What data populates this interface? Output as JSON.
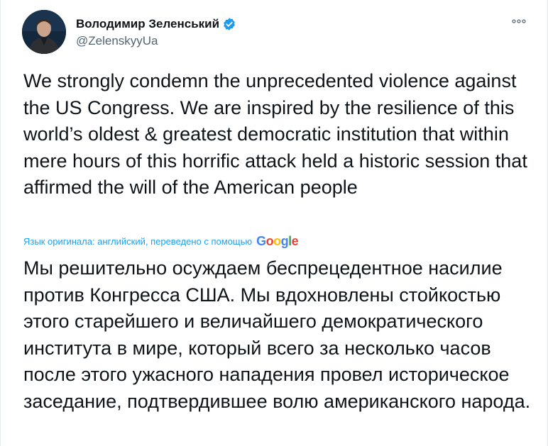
{
  "author": {
    "display_name": "Володимир Зеленський",
    "handle": "@ZelenskyyUa",
    "verified": true
  },
  "icons": {
    "verified": "verified-badge-icon",
    "more": "more-options-icon"
  },
  "colors": {
    "text": "#0f1419",
    "secondary": "#536471",
    "link": "#1da1f2",
    "verified": "#1d9bf0"
  },
  "tweet": {
    "text": "We strongly condemn the unprecedented violence against the US Congress. We are inspired by the resilience of this world’s oldest & greatest democratic institution that within mere hours of this horrific  attack held a historic session that affirmed the will of the American people",
    "translation_label": "Язык оригинала: английский, переведено с помощью",
    "translation_provider": "Google",
    "translated_text": "Мы решительно осуждаем беспрецедентное насилие против Конгресса США. Мы вдохновлены стойкостью этого старейшего и величайшего демократического института в мире, который всего за несколько часов после этого ужасного нападения провел историческое заседание, подтвердившее волю американского народа."
  }
}
